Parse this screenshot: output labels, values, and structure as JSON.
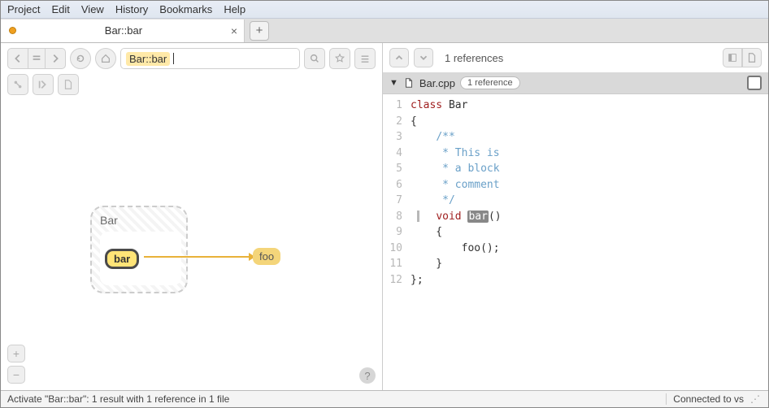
{
  "menu": {
    "items": [
      "Project",
      "Edit",
      "View",
      "History",
      "Bookmarks",
      "Help"
    ]
  },
  "tab": {
    "title": "Bar::bar"
  },
  "search": {
    "highlight": "Bar::bar"
  },
  "graph": {
    "outer": "Bar",
    "node_a": "bar",
    "node_b": "foo"
  },
  "refs": {
    "count_label": "1 references",
    "file": "Bar.cpp",
    "pill": "1 reference"
  },
  "code": {
    "lines": [
      {
        "n": 1,
        "html": "<span class='kw-class'>class</span> <span class='ident'>Bar</span>"
      },
      {
        "n": 2,
        "html": "{"
      },
      {
        "n": 3,
        "html": "    <span class='cmt'>/**</span>"
      },
      {
        "n": 4,
        "html": "    <span class='cmt'> * This is</span>"
      },
      {
        "n": 5,
        "html": "    <span class='cmt'> * a block</span>"
      },
      {
        "n": 6,
        "html": "    <span class='cmt'> * comment</span>"
      },
      {
        "n": 7,
        "html": "    <span class='cmt'> */</span>"
      },
      {
        "n": 8,
        "html": "    <span class='kw-void'>void</span> <span class='sel'>bar</span>()",
        "active": true
      },
      {
        "n": 9,
        "html": "    {"
      },
      {
        "n": 10,
        "html": "        foo();"
      },
      {
        "n": 11,
        "html": "    }"
      },
      {
        "n": 12,
        "html": "};"
      }
    ]
  },
  "status": {
    "left": "Activate \"Bar::bar\": 1 result with 1 reference in 1 file",
    "right": "Connected to vs"
  }
}
